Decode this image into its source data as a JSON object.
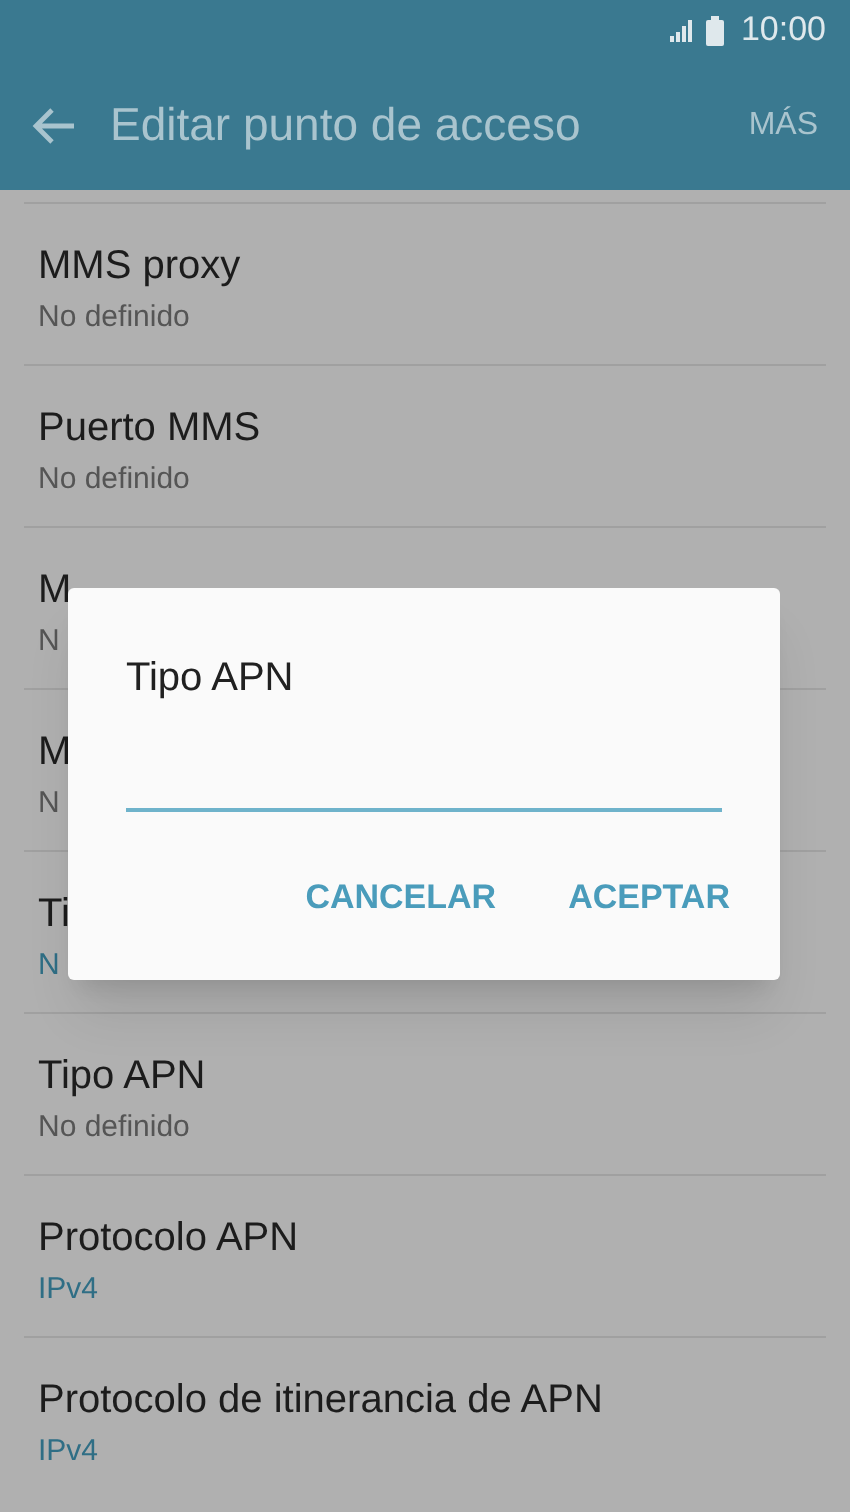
{
  "status_bar": {
    "time": "10:00"
  },
  "app_bar": {
    "title": "Editar punto de acceso",
    "action": "MÁS"
  },
  "settings": [
    {
      "title": "MMS proxy",
      "value": "No definido",
      "highlighted": false
    },
    {
      "title": "Puerto MMS",
      "value": "No definido",
      "highlighted": false
    },
    {
      "title": "M",
      "value": "N",
      "highlighted": false
    },
    {
      "title": "M",
      "value": "N",
      "highlighted": false
    },
    {
      "title": "Ti",
      "value": "N",
      "highlighted": true
    },
    {
      "title": "Tipo APN",
      "value": "No definido",
      "highlighted": false
    },
    {
      "title": "Protocolo APN",
      "value": "IPv4",
      "highlighted": true
    },
    {
      "title": "Protocolo de itinerancia de APN",
      "value": "IPv4",
      "highlighted": true
    }
  ],
  "dialog": {
    "title": "Tipo APN",
    "buttons": [
      "CANCELAR",
      "ACEPTAR"
    ]
  }
}
